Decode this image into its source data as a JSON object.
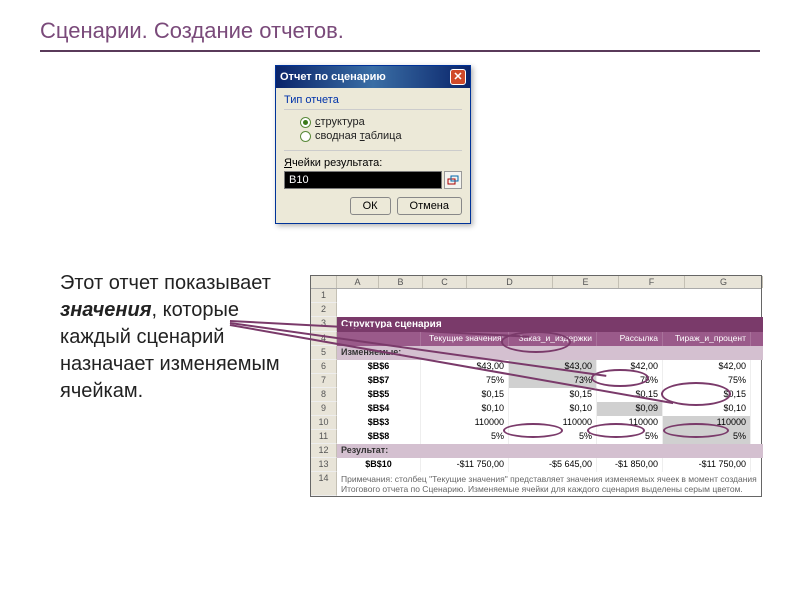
{
  "title": "Сценарии. Создание отчетов.",
  "dialog": {
    "title": "Отчет по сценарию",
    "group_label": "Тип отчета",
    "opt1": "структура",
    "opt2": "сводная таблица",
    "cells_label": "Ячейки результата:",
    "input_value": "B10",
    "ok": "ОК",
    "cancel": "Отмена"
  },
  "body": {
    "prefix": "Этот отчет показывает ",
    "em": "значения",
    "suffix": ", которые каждый сценарий назначает изменяемым ячейкам."
  },
  "excel": {
    "cols": [
      "A",
      "B",
      "C",
      "D",
      "E",
      "F",
      "G"
    ],
    "structure_title": "Структура сценария",
    "headers": [
      "",
      "Текущие значения:",
      "Заказ_и_издержки",
      "Рассылка",
      "Тираж_и_процент"
    ],
    "changing_label": "Изменяемые:",
    "result_label": "Результат:",
    "rows": [
      {
        "cell": "$B$6",
        "v": [
          "$43,00",
          "$43,00",
          "$42,00",
          "$42,00"
        ]
      },
      {
        "cell": "$B$7",
        "v": [
          "75%",
          "73%",
          "75%",
          "75%"
        ]
      },
      {
        "cell": "$B$5",
        "v": [
          "$0,15",
          "$0,15",
          "$0,15",
          "$0,15"
        ]
      },
      {
        "cell": "$B$4",
        "v": [
          "$0,10",
          "$0,10",
          "$0,09",
          "$0,10"
        ]
      },
      {
        "cell": "$B$3",
        "v": [
          "110000",
          "110000",
          "110000",
          "110000"
        ]
      },
      {
        "cell": "$B$8",
        "v": [
          "5%",
          "5%",
          "5%",
          "5%"
        ]
      }
    ],
    "result": {
      "cell": "$B$10",
      "v": [
        "-$11 750,00",
        "-$5 645,00",
        "-$1 850,00",
        "-$11 750,00"
      ]
    },
    "note": "Примечания: столбец \"Текущие значения\" представляет значения изменяемых ячеек в момент создания Итогового отчета по Сценарию. Изменяемые ячейки для каждого сценария выделены серым цветом."
  }
}
